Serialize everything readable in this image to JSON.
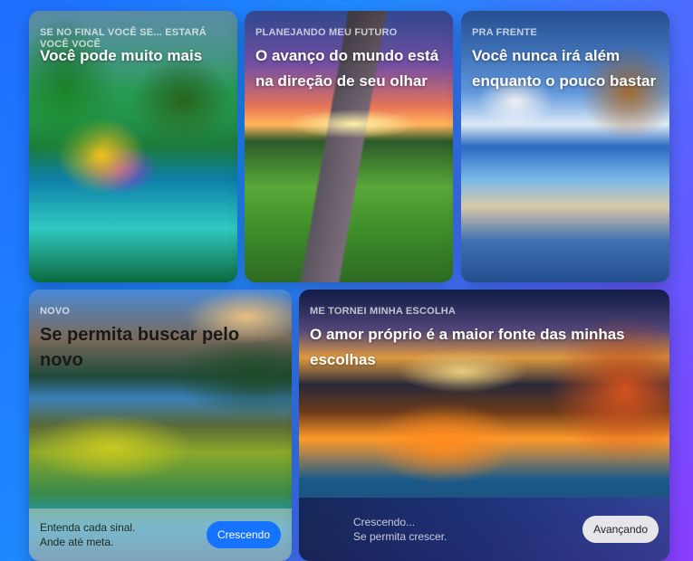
{
  "cards": [
    {
      "eyebrow": "SE NO FINAL VOCÊ SE... ESTARÁ VOCÊ VOCÊ",
      "title": "Você pode muito mais"
    },
    {
      "eyebrow": "PLANEJANDO MEU FUTURO",
      "title": "O avanço do mundo está na direção de seu olhar"
    },
    {
      "eyebrow": "PRA FRENTE",
      "title": "Você nunca irá além enquanto o pouco bastar"
    },
    {
      "eyebrow": "NOVO",
      "title": "Se permita buscar pelo novo",
      "footer_line1": "Entenda cada sinal.",
      "footer_line2": "Ande até meta.",
      "button": "Crescendo"
    },
    {
      "eyebrow": "ME TORNEI MINHA ESCOLHA",
      "title": "O amor próprio é a maior fonte das minhas escolhas",
      "footer_line1": "Crescendo...",
      "footer_line2": "Se permita crescer.",
      "button": "Avançando"
    }
  ],
  "colors": {
    "primary_button": "#1673ff",
    "secondary_button": "#e6e6ea"
  }
}
